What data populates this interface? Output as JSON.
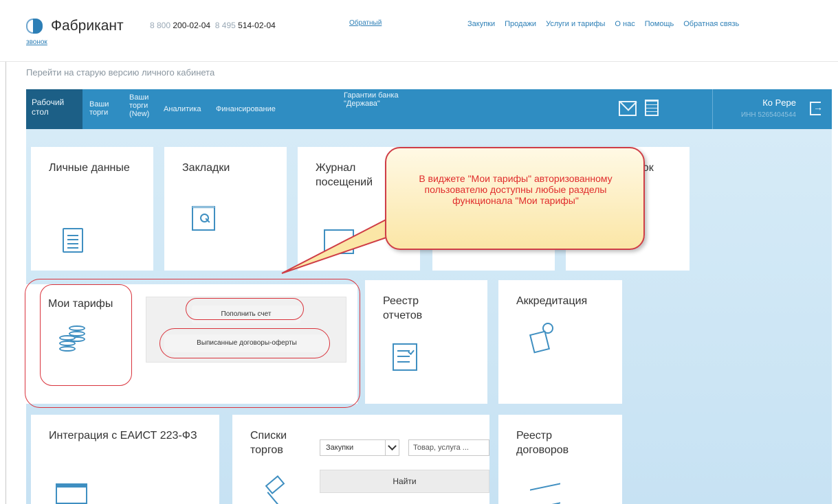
{
  "header": {
    "logo_text": "Фабрикант",
    "phone1_prefix": "8 800",
    "phone1": "200-02-04",
    "phone2_prefix": "8 495",
    "phone2": "514-02-04",
    "callback_part1": "Обратный",
    "callback_part2": "звонок",
    "nav": [
      "Закупки",
      "Продажи",
      "Услуги и тарифы",
      "О нас",
      "Помощь",
      "Обратная связь"
    ]
  },
  "old_version_link": "Перейти на старую версию личного кабинета",
  "menu": {
    "items": [
      {
        "label": "Рабочий стол"
      },
      {
        "label": "Ваши торги"
      },
      {
        "label": "Ваши торги (New)"
      },
      {
        "label": "Аналитика"
      },
      {
        "label": "Финансирование"
      },
      {
        "label": "Гарантии банка \"Держава\""
      }
    ],
    "user_name": "Ко Pepe",
    "user_inn": "ИНН 5265404544"
  },
  "tiles": {
    "personal_data": "Личные данные",
    "bookmarks": "Закладки",
    "visit_log": "Журнал посещений",
    "purchases_partial": "купок",
    "my_tariffs": "Мои тарифы",
    "reports_registry": "Реестр отчетов",
    "accreditation": "Аккредитация",
    "eaist_integration": "Интеграция с ЕАИСТ 223-ФЗ",
    "tender_lists": "Списки торгов",
    "contracts_registry": "Реестр договоров"
  },
  "tariff_actions": {
    "topup": "Пополнить счет",
    "contracts": "Выписанные договоры-оферты"
  },
  "search": {
    "select_value": "Закупки",
    "placeholder": "Товар, услуга ...",
    "find_label": "Найти"
  },
  "callout": {
    "text": "В виджете \"Мои тарифы\" авторизованному пользователю доступны любые разделы функционала \"Мои тарифы\""
  },
  "colors": {
    "menu_blue": "#2f8dc2",
    "menu_active": "#1c5f86",
    "icon_blue": "#3f8fc1",
    "annotation_red": "#d9333c",
    "callout_bg": "#fbe6a6"
  }
}
